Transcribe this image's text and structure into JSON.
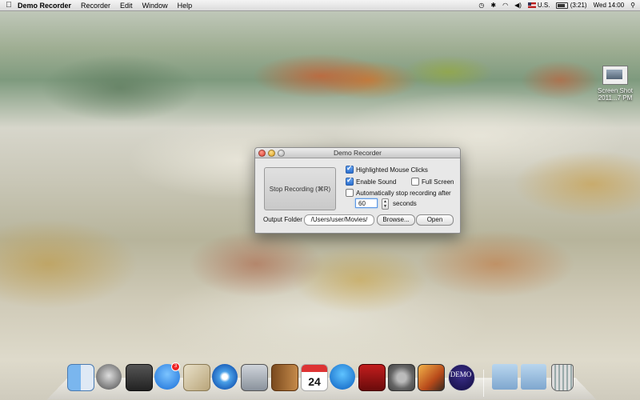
{
  "menubar": {
    "apple": "",
    "app_name": "Demo Recorder",
    "items": [
      "Recorder",
      "Edit",
      "Window",
      "Help"
    ],
    "input_source": "U.S.",
    "battery": "(3:21)",
    "clock": "Wed 14:00"
  },
  "desktop": {
    "file_label_line1": "Screen Shot",
    "file_label_line2": "2011...7 PM"
  },
  "window": {
    "title": "Demo Recorder",
    "stop_button": "Stop Recording (⌘R)",
    "opt_highlight": "Highlighted Mouse Clicks",
    "opt_sound": "Enable Sound",
    "opt_fullscreen": "Full Screen",
    "opt_autostop": "Automatically stop recording after",
    "seconds_value": "60",
    "seconds_label": "seconds",
    "output_label": "Output Folder",
    "output_path": "/Users/user/Movies/",
    "browse": "Browse...",
    "open": "Open"
  },
  "dock": {
    "appstore_badge": "3",
    "demo_label": "DEMO",
    "icons": [
      "finder-icon",
      "launchpad-icon",
      "photo-booth-icon",
      "app-store-icon",
      "mail-icon",
      "safari-icon",
      "facetime-icon",
      "address-book-icon",
      "ical-icon",
      "itunes-icon",
      "photo-booth2-icon",
      "system-preferences-icon",
      "iphoto-icon",
      "demo-recorder-icon",
      "documents-folder-icon",
      "downloads-folder-icon",
      "trash-icon"
    ]
  }
}
